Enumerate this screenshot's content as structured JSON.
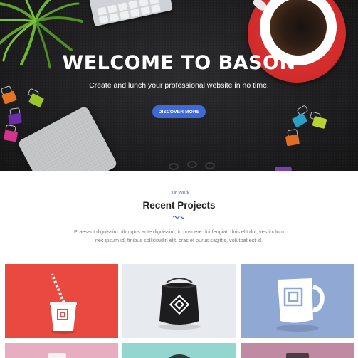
{
  "hero": {
    "title": "WELCOME TO BASON",
    "subtitle": "Create and lunch your professional website in no time.",
    "cta_label": "DISCOVER MORE"
  },
  "work": {
    "eyebrow": "Our Work",
    "title": "Recent Projects",
    "description": "Praesent dignissim nibh quis ante dignissim, in posuere dui feugiat. duis elit dui, vestibulum nec ipsum id, finibus sollicitudin elit. cras et purus sagittis, volutpat est id."
  },
  "projects": [
    {
      "name": "paper-cup-mockup",
      "color": "#e9493f"
    },
    {
      "name": "drawstring-bag-mockup",
      "color": "#e7ebef"
    },
    {
      "name": "mug-mockup",
      "color": "#8fa8d4"
    },
    {
      "name": "pink-mockup",
      "color": "#e6aec0"
    },
    {
      "name": "teal-mockup",
      "color": "#93d5cf"
    },
    {
      "name": "mauve-mockup",
      "color": "#c08aa2"
    }
  ],
  "colors": {
    "accent": "#3d6ad6",
    "hero_bg": "#1e1e20",
    "heading": "#222222",
    "body_text": "#7a7a7a"
  }
}
